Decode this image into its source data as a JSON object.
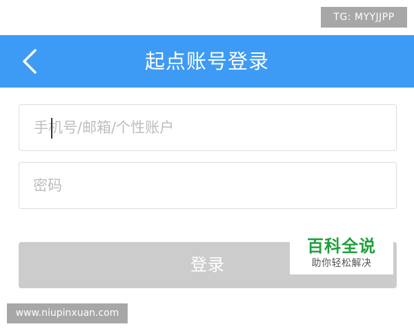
{
  "watermark_top": "TG: MYYJJPP",
  "header": {
    "title": "起点账号登录",
    "back_icon": "chevron-left-icon",
    "background_color": "#3d9bf5"
  },
  "form": {
    "account_placeholder": "手机号/邮箱/个性账户",
    "password_placeholder": "密码",
    "login_label": "登录",
    "login_button_color": "#cccccc"
  },
  "baike_watermark": {
    "title": "百科全说",
    "subtitle": "助你轻松解决",
    "title_color": "#1f9f3b"
  },
  "watermark_bottom": "www.niupinxuan.com"
}
